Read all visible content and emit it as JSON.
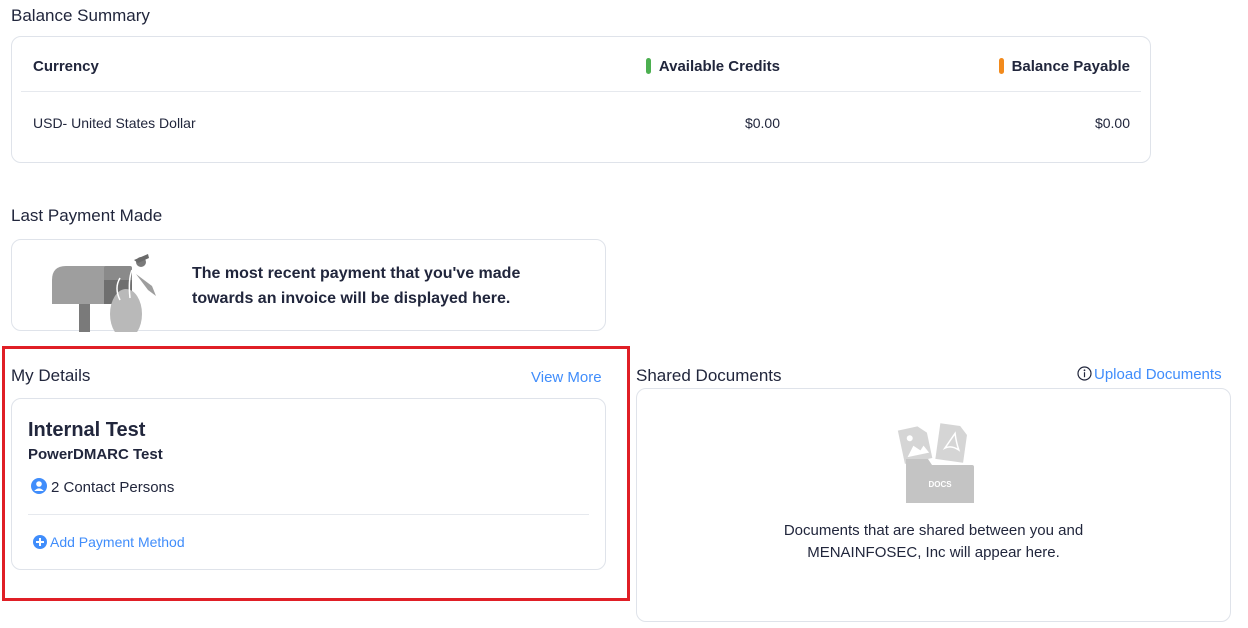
{
  "balance_summary": {
    "title": "Balance Summary",
    "columns": {
      "currency": "Currency",
      "credits": "Available Credits",
      "payable": "Balance Payable"
    },
    "rows": [
      {
        "currency": "USD- United States Dollar",
        "credits": "$0.00",
        "payable": "$0.00"
      }
    ],
    "colors": {
      "credits_marker": "#4caf50",
      "payable_marker": "#f28a1c"
    }
  },
  "last_payment": {
    "title": "Last Payment Made",
    "message_line1": "The most recent payment that you've made",
    "message_line2": "towards an invoice will be displayed here."
  },
  "my_details": {
    "title": "My Details",
    "view_more": "View More",
    "name": "Internal Test",
    "company": "PowerDMARC Test",
    "contacts": "2 Contact Persons",
    "add_payment": "Add Payment Method"
  },
  "shared_documents": {
    "title": "Shared Documents",
    "upload": "Upload Documents",
    "docs_label": "DOCS",
    "message_line1": "Documents that are shared between you and",
    "message_line2": "MENAINFOSEC, Inc will appear here."
  },
  "colors": {
    "link": "#408dfb",
    "highlight": "#e01f26"
  }
}
